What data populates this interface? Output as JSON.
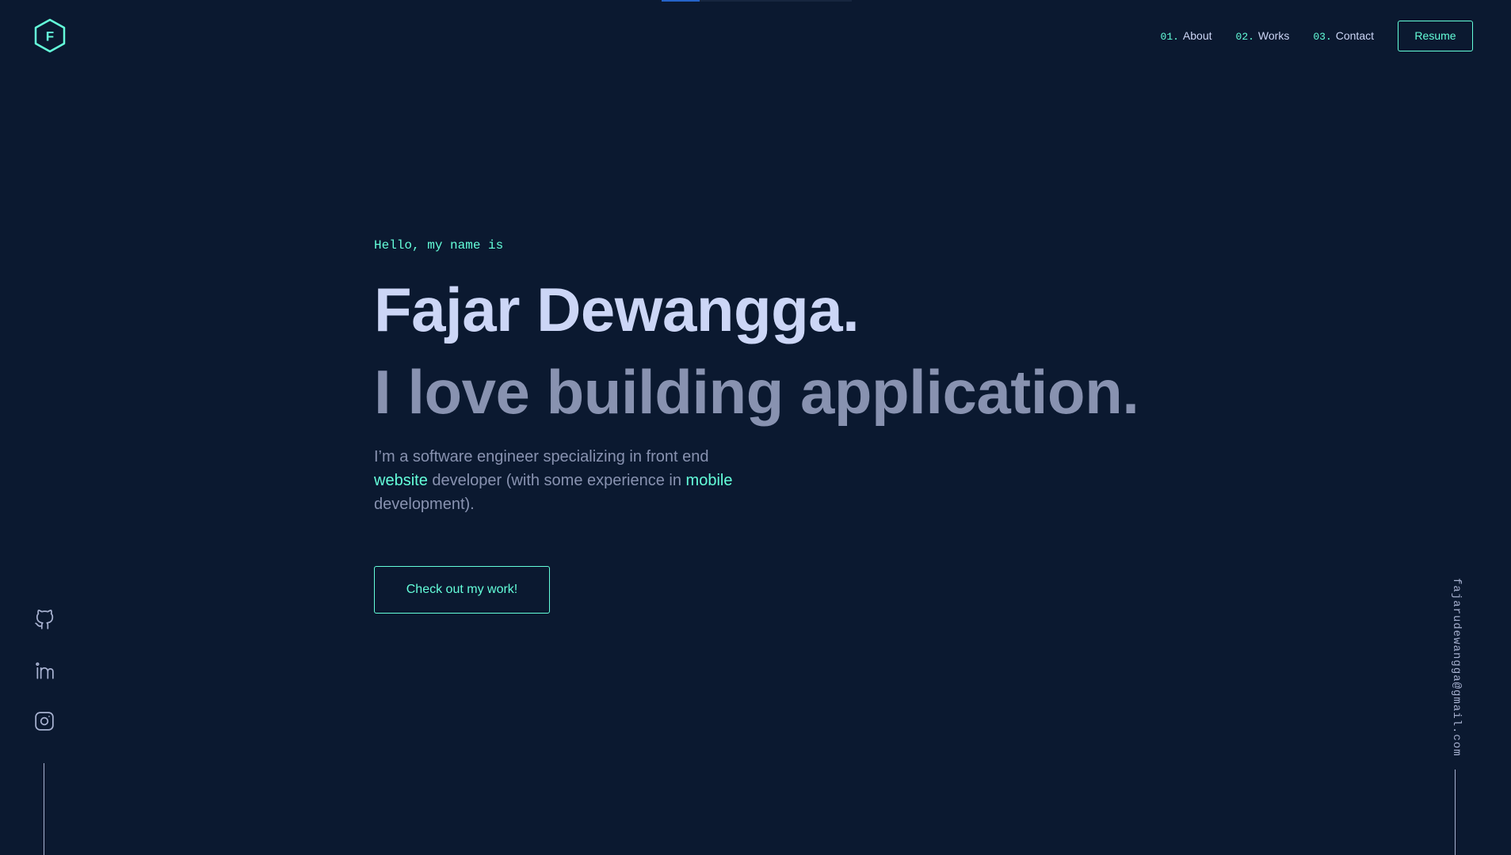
{
  "top_progress": {
    "fraction": 0.2
  },
  "logo": {
    "letter": "F",
    "icon": "hexagon-logo-icon"
  },
  "nav": {
    "items": [
      {
        "num": "01.",
        "label": "About"
      },
      {
        "num": "02.",
        "label": "Works"
      },
      {
        "num": "03.",
        "label": "Contact"
      }
    ],
    "resume_label": "Resume"
  },
  "hero": {
    "greeting": "Hello, my name is",
    "name": "Fajar Dewangga.",
    "tagline": "I love building application.",
    "bio": {
      "part1": "I’m a software engineer specializing in front end ",
      "highlight1": "website",
      "part2": " developer (with some experience in ",
      "highlight2": "mobile",
      "part3": " development)."
    },
    "cta_label": "Check out my work!"
  },
  "social": {
    "icons": [
      "github-icon",
      "linkedin-icon",
      "instagram-icon"
    ]
  },
  "email": "fajarudewangga@gmail.com",
  "colors": {
    "background": "#0b1930",
    "accent": "#64ffda",
    "heading": "#ccd6f6",
    "muted": "#8892b0",
    "progress": "#2563c9"
  }
}
